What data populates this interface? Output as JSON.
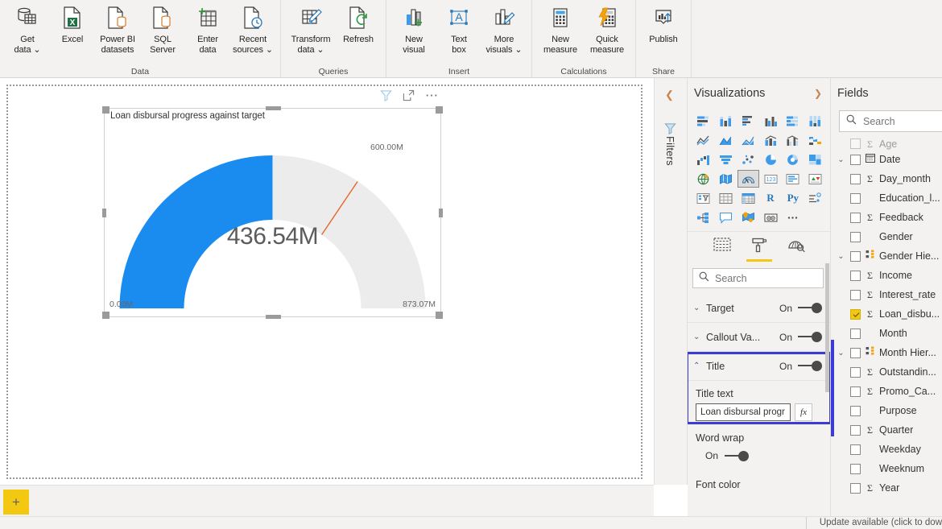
{
  "ribbon": {
    "groups": [
      {
        "name": "Data",
        "buttons": [
          {
            "label": "Get\ndata ⌄",
            "icon": "get-data-icon"
          },
          {
            "label": "Excel",
            "icon": "excel-icon"
          },
          {
            "label": "Power BI\ndatasets",
            "icon": "powerbi-datasets-icon"
          },
          {
            "label": "SQL\nServer",
            "icon": "sql-server-icon"
          },
          {
            "label": "Enter\ndata",
            "icon": "enter-data-icon"
          },
          {
            "label": "Recent\nsources ⌄",
            "icon": "recent-sources-icon"
          }
        ]
      },
      {
        "name": "Queries",
        "buttons": [
          {
            "label": "Transform\ndata ⌄",
            "icon": "transform-data-icon"
          },
          {
            "label": "Refresh",
            "icon": "refresh-icon"
          }
        ]
      },
      {
        "name": "Insert",
        "buttons": [
          {
            "label": "New\nvisual",
            "icon": "new-visual-icon"
          },
          {
            "label": "Text\nbox",
            "icon": "text-box-icon"
          },
          {
            "label": "More\nvisuals ⌄",
            "icon": "more-visuals-icon"
          }
        ]
      },
      {
        "name": "Calculations",
        "buttons": [
          {
            "label": "New\nmeasure",
            "icon": "new-measure-icon"
          },
          {
            "label": "Quick\nmeasure",
            "icon": "quick-measure-icon"
          }
        ]
      },
      {
        "name": "Share",
        "buttons": [
          {
            "label": "Publish",
            "icon": "publish-icon"
          }
        ]
      }
    ]
  },
  "visual_header": {
    "filter_icon": "filter-funnel-icon",
    "focus_icon": "focus-mode-icon",
    "more_icon": "more-options-icon"
  },
  "gauge": {
    "title": "Loan disbursal progress against target",
    "callout_value": "436.54M",
    "min_label": "0.00M",
    "max_label": "873.07M",
    "target_label": "600.00M",
    "fill_color": "#1a8cf0",
    "track_color": "#ececec",
    "target_color": "#e8652b",
    "value_color": "#5b5b5b"
  },
  "chart_data": {
    "type": "gauge",
    "title": "Loan disbursal progress against target",
    "value": 436.54,
    "min": 0.0,
    "max": 873.07,
    "target": 600.0,
    "unit": "M",
    "percent_of_max": 50.0,
    "fill_color": "#1a8cf0",
    "track_color": "#ececec",
    "target_color": "#e8652b"
  },
  "filters_rail": {
    "collapse_icon": "chevron-left-icon",
    "funnel_icon": "filter-funnel-icon",
    "label": "Filters"
  },
  "visualizations": {
    "title": "Visualizations",
    "expand_icon": "chevron-right-icon",
    "icons": [
      "stacked-bar-chart-icon",
      "stacked-column-chart-icon",
      "clustered-bar-chart-icon",
      "clustered-column-chart-icon",
      "100-stacked-bar-chart-icon",
      "100-stacked-column-chart-icon",
      "line-chart-icon",
      "area-chart-icon",
      "stacked-area-chart-icon",
      "line-stacked-column-chart-icon",
      "line-clustered-column-chart-icon",
      "ribbon-chart-icon",
      "waterfall-chart-icon",
      "funnel-chart-icon",
      "scatter-chart-icon",
      "pie-chart-icon",
      "donut-chart-icon",
      "treemap-icon",
      "map-icon",
      "filled-map-icon",
      "gauge-icon",
      "card-icon",
      "multi-row-card-icon",
      "kpi-icon",
      "slicer-icon",
      "table-icon",
      "matrix-icon",
      "r-script-visual-icon",
      "python-visual-icon",
      "key-influencers-icon",
      "decomposition-tree-icon",
      "q-and-a-icon",
      "arcgis-maps-icon",
      "paginated-report-icon",
      "more-visuals-ellipsis-icon"
    ],
    "selected_icon": "gauge-icon",
    "tabs": [
      {
        "name": "fields-tab",
        "icon": "fields-tab-icon",
        "active": false
      },
      {
        "name": "format-tab",
        "icon": "paint-roller-icon",
        "active": true
      },
      {
        "name": "analytics-tab",
        "icon": "analytics-magnifier-icon",
        "active": false
      }
    ],
    "search_placeholder": "Search",
    "search_value": "",
    "format_sections": [
      {
        "name": "Target",
        "state": "On",
        "expanded": false,
        "caret": "⌄"
      },
      {
        "name": "Callout Va...",
        "state": "On",
        "expanded": false,
        "caret": "⌄"
      },
      {
        "name": "Title",
        "state": "On",
        "expanded": true,
        "caret": "⌃"
      }
    ],
    "title_text_label": "Title text",
    "title_text_value": "Loan disbursal progr",
    "fx_label": "fx",
    "word_wrap_label": "Word wrap",
    "word_wrap_state": "On",
    "font_color_label": "Font color",
    "highlight_color": "#3b3bd6"
  },
  "fields": {
    "title": "Fields",
    "search_placeholder": "Search",
    "search_value": "",
    "items": [
      {
        "label": "Age",
        "caret": "",
        "checked": false,
        "sigma": true,
        "partial": true
      },
      {
        "label": "Date",
        "caret": "⌄",
        "checked": false,
        "icon": "calendar-icon"
      },
      {
        "label": "Day_month",
        "caret": "",
        "checked": false,
        "sigma": true
      },
      {
        "label": "Education_l...",
        "caret": "",
        "checked": false,
        "sigma": false
      },
      {
        "label": "Feedback",
        "caret": "",
        "checked": false,
        "sigma": true
      },
      {
        "label": "Gender",
        "caret": "",
        "checked": false,
        "sigma": false
      },
      {
        "label": "Gender Hie...",
        "caret": "⌄",
        "checked": false,
        "icon": "hierarchy-icon"
      },
      {
        "label": "Income",
        "caret": "",
        "checked": false,
        "sigma": true
      },
      {
        "label": "Interest_rate",
        "caret": "",
        "checked": false,
        "sigma": true
      },
      {
        "label": "Loan_disbu...",
        "caret": "",
        "checked": true,
        "sigma": true
      },
      {
        "label": "Month",
        "caret": "",
        "checked": false,
        "sigma": false
      },
      {
        "label": "Month Hier...",
        "caret": "⌄",
        "checked": false,
        "icon": "hierarchy-icon"
      },
      {
        "label": "Outstandin...",
        "caret": "",
        "checked": false,
        "sigma": true
      },
      {
        "label": "Promo_Ca...",
        "caret": "",
        "checked": false,
        "sigma": true
      },
      {
        "label": "Purpose",
        "caret": "",
        "checked": false,
        "sigma": false
      },
      {
        "label": "Quarter",
        "caret": "",
        "checked": false,
        "sigma": true
      },
      {
        "label": "Weekday",
        "caret": "",
        "checked": false,
        "sigma": false
      },
      {
        "label": "Weeknum",
        "caret": "",
        "checked": false,
        "sigma": false
      },
      {
        "label": "Year",
        "caret": "",
        "checked": false,
        "sigma": true
      }
    ]
  },
  "bottom": {
    "add_page_label": "+",
    "status_text": "Update available (click to dow"
  }
}
